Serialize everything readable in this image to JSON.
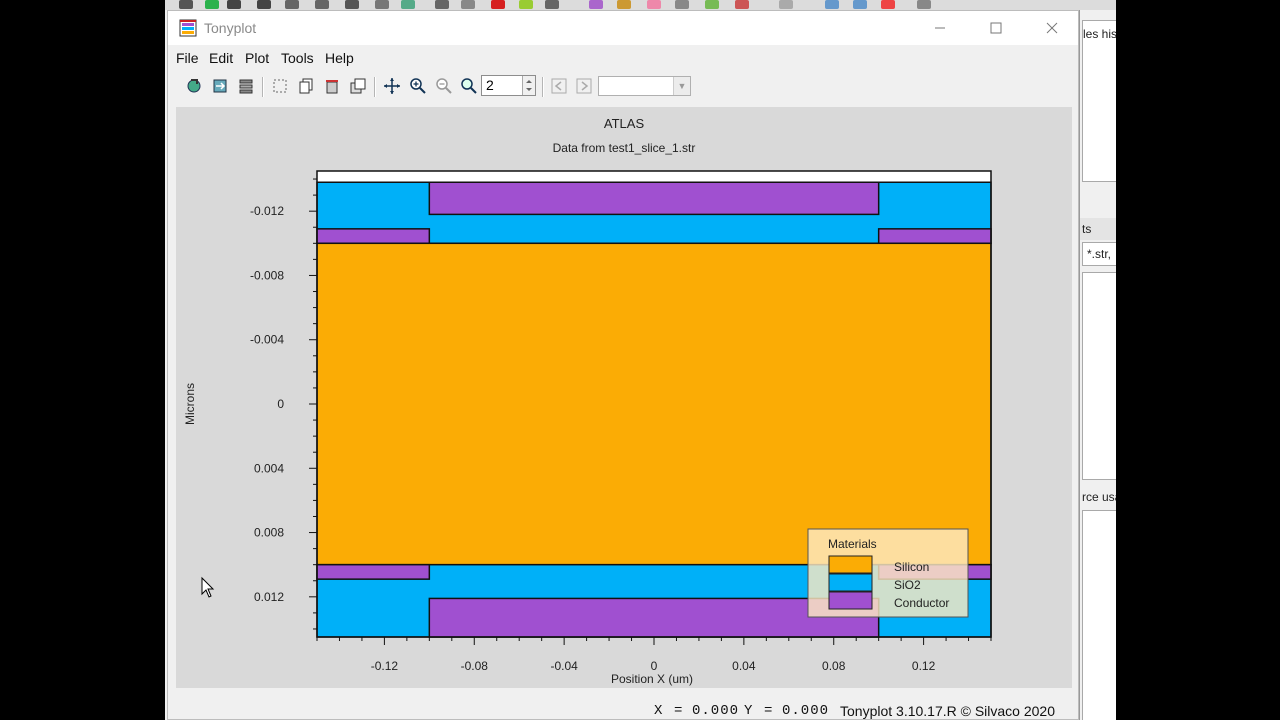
{
  "window": {
    "title": "Tonyplot",
    "minimize_icon": "minimize-icon",
    "maximize_icon": "maximize-icon",
    "close_icon": "close-icon"
  },
  "menu": {
    "items": [
      {
        "label": "File"
      },
      {
        "label": "Edit"
      },
      {
        "label": "Plot"
      },
      {
        "label": "Tools"
      },
      {
        "label": "Help"
      }
    ]
  },
  "toolbar": {
    "zoom_value": "2",
    "combo_value": ""
  },
  "plot": {
    "title": "ATLAS",
    "subtitle": "Data from test1_slice_1.str",
    "xlabel": "Position X (um)",
    "ylabel": "Microns",
    "legend_title": "Materials",
    "materials": [
      {
        "name": "Silicon",
        "color": "#fbac05"
      },
      {
        "name": "SiO2",
        "color": "#00b0f8"
      },
      {
        "name": "Conductor",
        "color": "#a050d0"
      }
    ]
  },
  "chart_data": {
    "type": "heatmap",
    "title": "ATLAS",
    "subtitle": "Data from test1_slice_1.str",
    "xlabel": "Position X (um)",
    "ylabel": "Microns",
    "xlim": [
      -0.15,
      0.15
    ],
    "ylim": [
      -0.0145,
      0.0145
    ],
    "y_inverted": true,
    "x_ticks": [
      "-0.12",
      "-0.08",
      "-0.04",
      "0",
      "0.04",
      "0.08",
      "0.12"
    ],
    "y_ticks": [
      "-0.012",
      "-0.008",
      "-0.004",
      "0",
      "0.004",
      "0.008",
      "0.012"
    ],
    "regions": [
      {
        "material": "SiO2",
        "x": [
          -0.15,
          0.15
        ],
        "y": [
          -0.0138,
          -0.01
        ]
      },
      {
        "material": "Conductor",
        "x": [
          -0.1,
          0.1
        ],
        "y": [
          -0.0138,
          -0.0118
        ]
      },
      {
        "material": "Conductor",
        "x": [
          -0.15,
          -0.1
        ],
        "y": [
          -0.0109,
          -0.01
        ]
      },
      {
        "material": "Conductor",
        "x": [
          0.1,
          0.15
        ],
        "y": [
          -0.0109,
          -0.01
        ]
      },
      {
        "material": "Silicon",
        "x": [
          -0.15,
          0.15
        ],
        "y": [
          -0.01,
          0.01
        ]
      },
      {
        "material": "SiO2",
        "x": [
          -0.15,
          0.15
        ],
        "y": [
          0.01,
          0.0145
        ]
      },
      {
        "material": "Conductor",
        "x": [
          -0.15,
          -0.1
        ],
        "y": [
          0.01,
          0.0109
        ]
      },
      {
        "material": "Conductor",
        "x": [
          0.1,
          0.15
        ],
        "y": [
          0.01,
          0.0109
        ]
      },
      {
        "material": "Conductor",
        "x": [
          -0.1,
          0.1
        ],
        "y": [
          0.0121,
          0.0145
        ]
      }
    ]
  },
  "status": {
    "x_label": "X",
    "x_value": "0.000",
    "y_label": "Y",
    "y_value": "0.000",
    "version": "Tonyplot 3.10.17.R © Silvaco 2020"
  },
  "background_app": {
    "text1": "les his",
    "text2": "ts",
    "filter": "*.str,",
    "text3": "rce usa"
  }
}
